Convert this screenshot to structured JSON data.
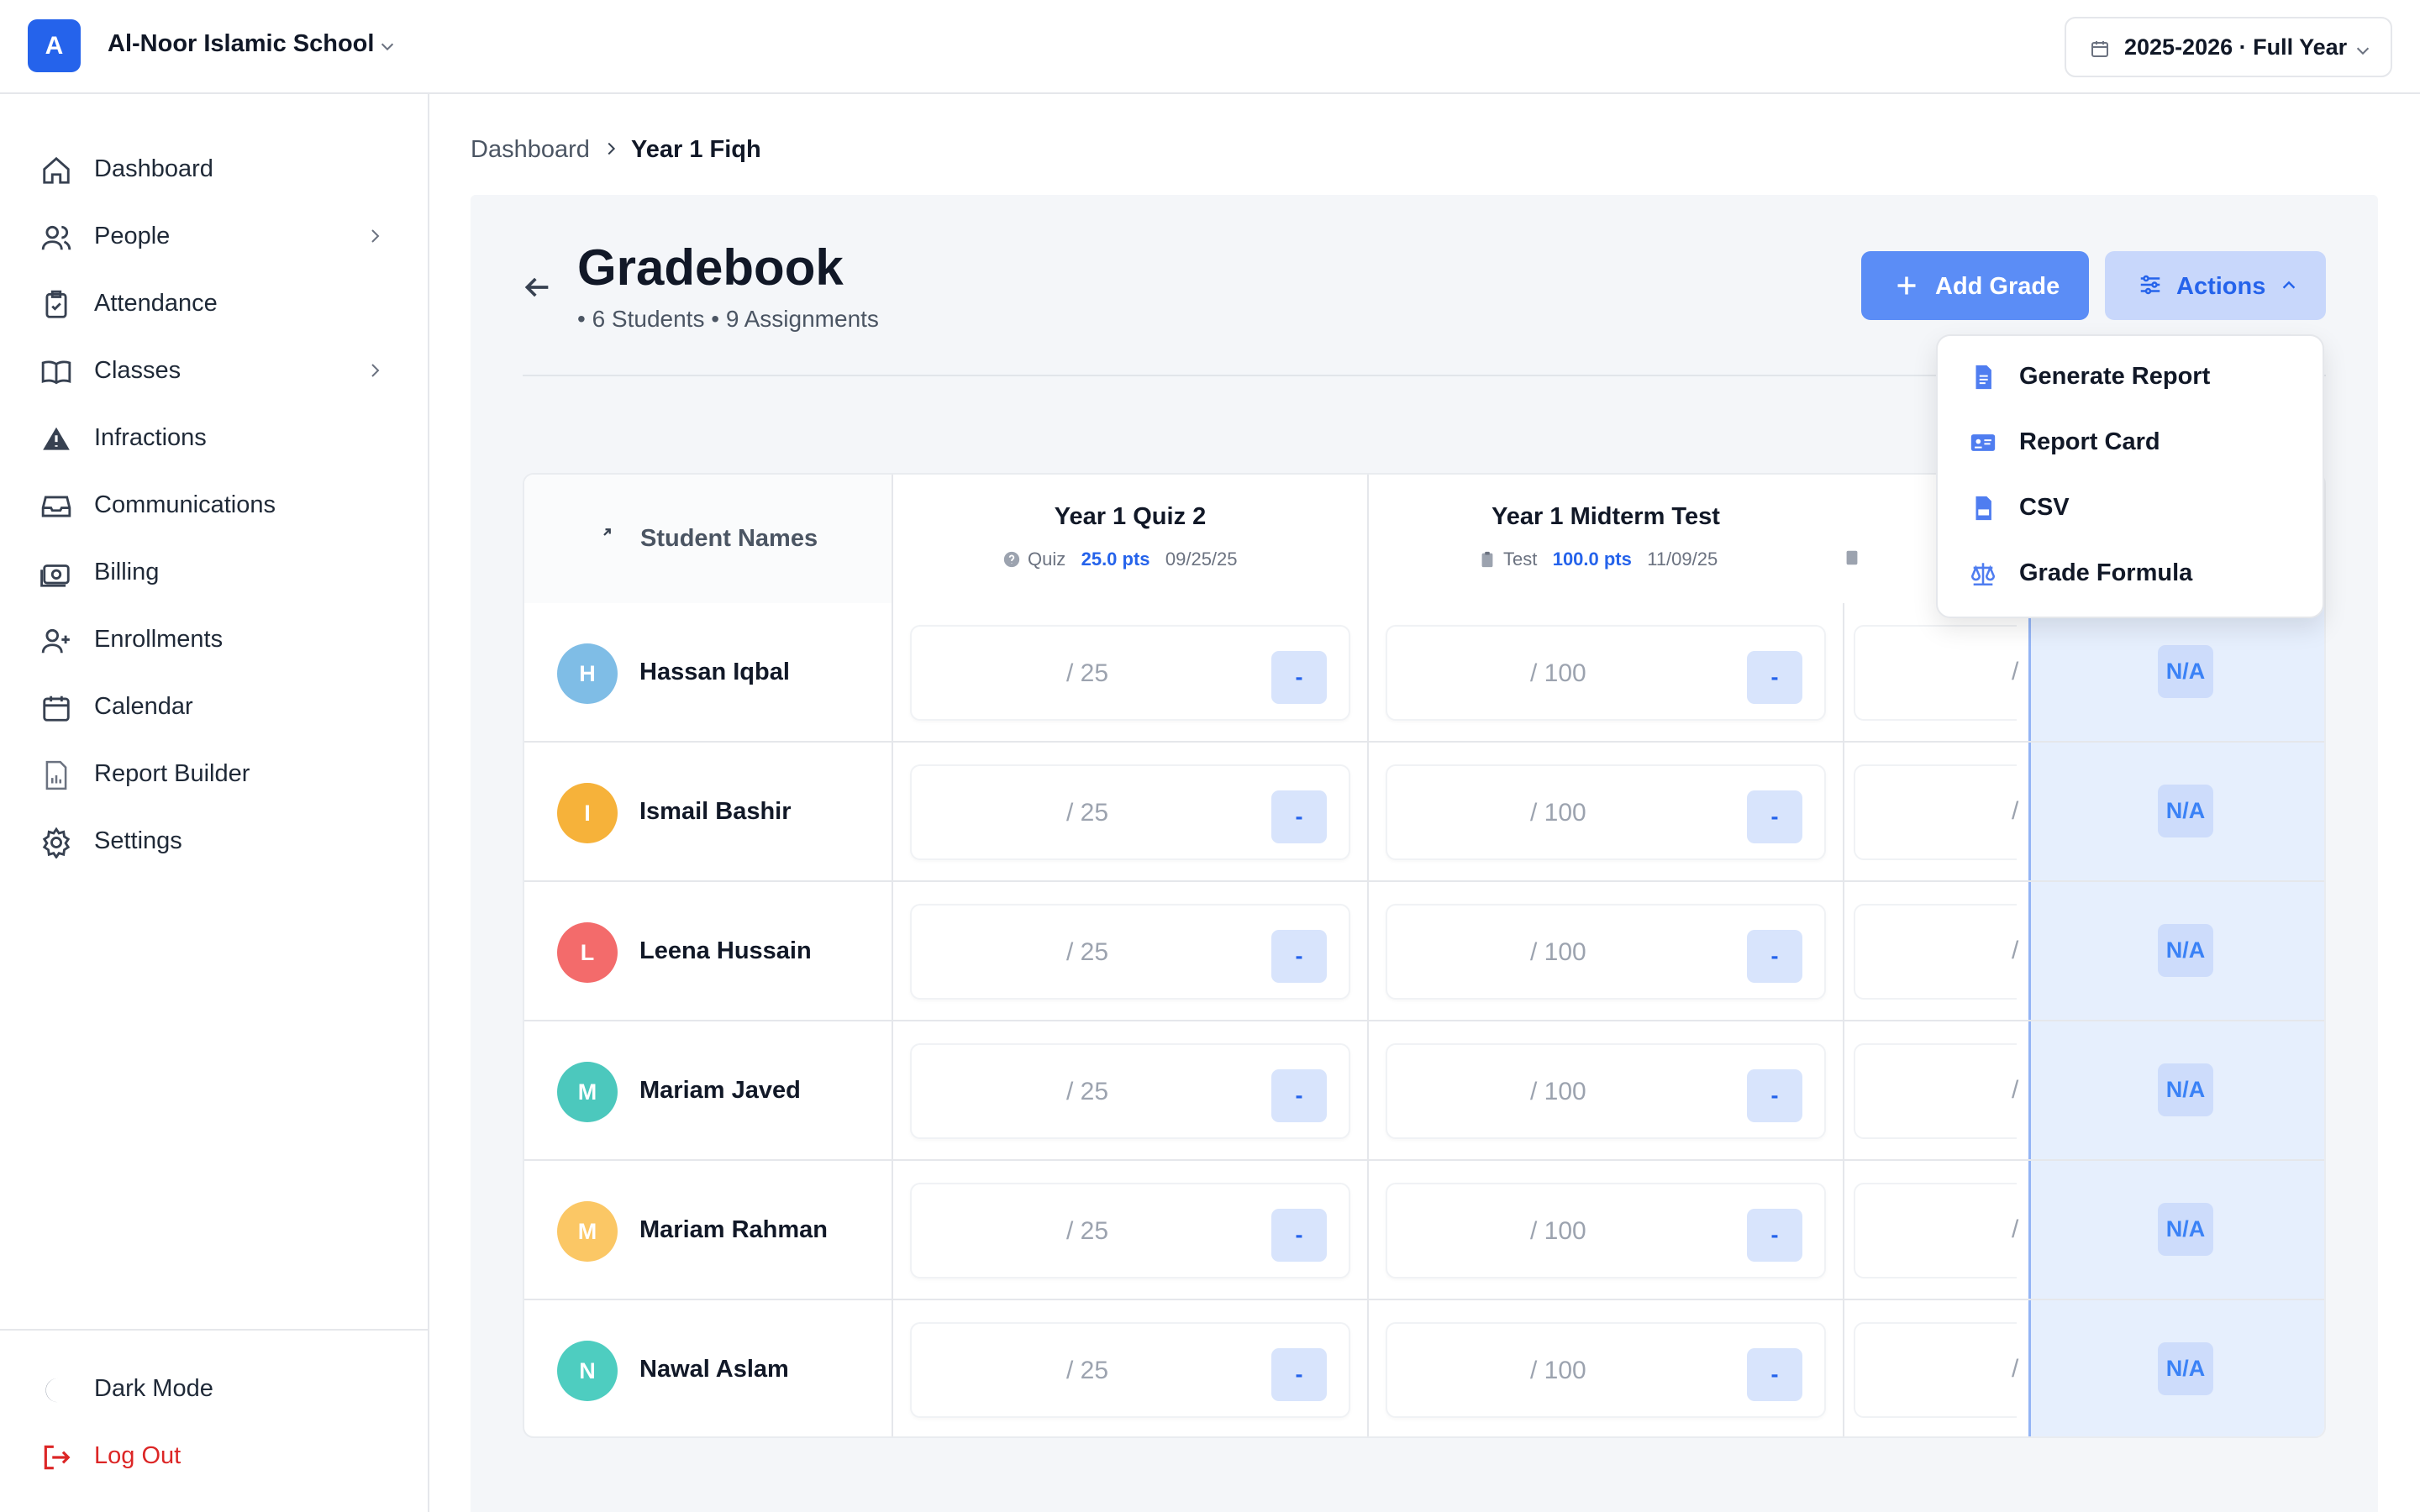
{
  "topbar": {
    "logo_letter": "A",
    "school_name": "Al-Noor Islamic School",
    "year_selector": "2025-2026 · Full Year"
  },
  "sidebar": {
    "items": [
      {
        "label": "Dashboard",
        "icon": "home-icon"
      },
      {
        "label": "People",
        "icon": "users-icon",
        "has_submenu": true
      },
      {
        "label": "Attendance",
        "icon": "clipboard-check-icon"
      },
      {
        "label": "Classes",
        "icon": "book-icon",
        "has_submenu": true
      },
      {
        "label": "Infractions",
        "icon": "warning-icon"
      },
      {
        "label": "Communications",
        "icon": "inbox-icon"
      },
      {
        "label": "Billing",
        "icon": "money-icon"
      },
      {
        "label": "Enrollments",
        "icon": "user-plus-icon"
      },
      {
        "label": "Calendar",
        "icon": "calendar-icon"
      },
      {
        "label": "Report Builder",
        "icon": "report-icon"
      },
      {
        "label": "Settings",
        "icon": "gear-icon"
      }
    ],
    "dark_mode": "Dark Mode",
    "logout": "Log Out"
  },
  "breadcrumb": {
    "root": "Dashboard",
    "current": "Year 1 Fiqh"
  },
  "header": {
    "title": "Gradebook",
    "meta": "• 6 Students • 9 Assignments",
    "add_grade": "Add Grade",
    "actions": "Actions"
  },
  "actions_menu": [
    {
      "label": "Generate Report",
      "icon": "document-icon"
    },
    {
      "label": "Report Card",
      "icon": "id-card-icon"
    },
    {
      "label": "CSV",
      "icon": "csv-file-icon"
    },
    {
      "label": "Grade Formula",
      "icon": "scale-icon"
    }
  ],
  "table": {
    "name_header": "Student Names",
    "assignments": [
      {
        "title": "Year 1 Quiz 2",
        "type": "Quiz",
        "points": "25.0 pts",
        "date": "09/25/25",
        "total": "/ 25"
      },
      {
        "title": "Year 1 Midterm Test",
        "type": "Test",
        "points": "100.0 pts",
        "date": "11/09/25",
        "total": "/ 100"
      }
    ],
    "empty_score": "-",
    "final_grade": "N/A",
    "partial_total": "/",
    "students": [
      {
        "name": "Hassan Iqbal",
        "initial": "H",
        "color": "#7fbde6"
      },
      {
        "name": "Ismail Bashir",
        "initial": "I",
        "color": "#f6b23a"
      },
      {
        "name": "Leena Hussain",
        "initial": "L",
        "color": "#f36b6b"
      },
      {
        "name": "Mariam Javed",
        "initial": "M",
        "color": "#4cc8bd"
      },
      {
        "name": "Mariam Rahman",
        "initial": "M",
        "color": "#fbc765"
      },
      {
        "name": "Nawal Aslam",
        "initial": "N",
        "color": "#4ecdc0"
      }
    ]
  },
  "colors": {
    "primary": "#2563eb",
    "danger": "#dc2626"
  }
}
